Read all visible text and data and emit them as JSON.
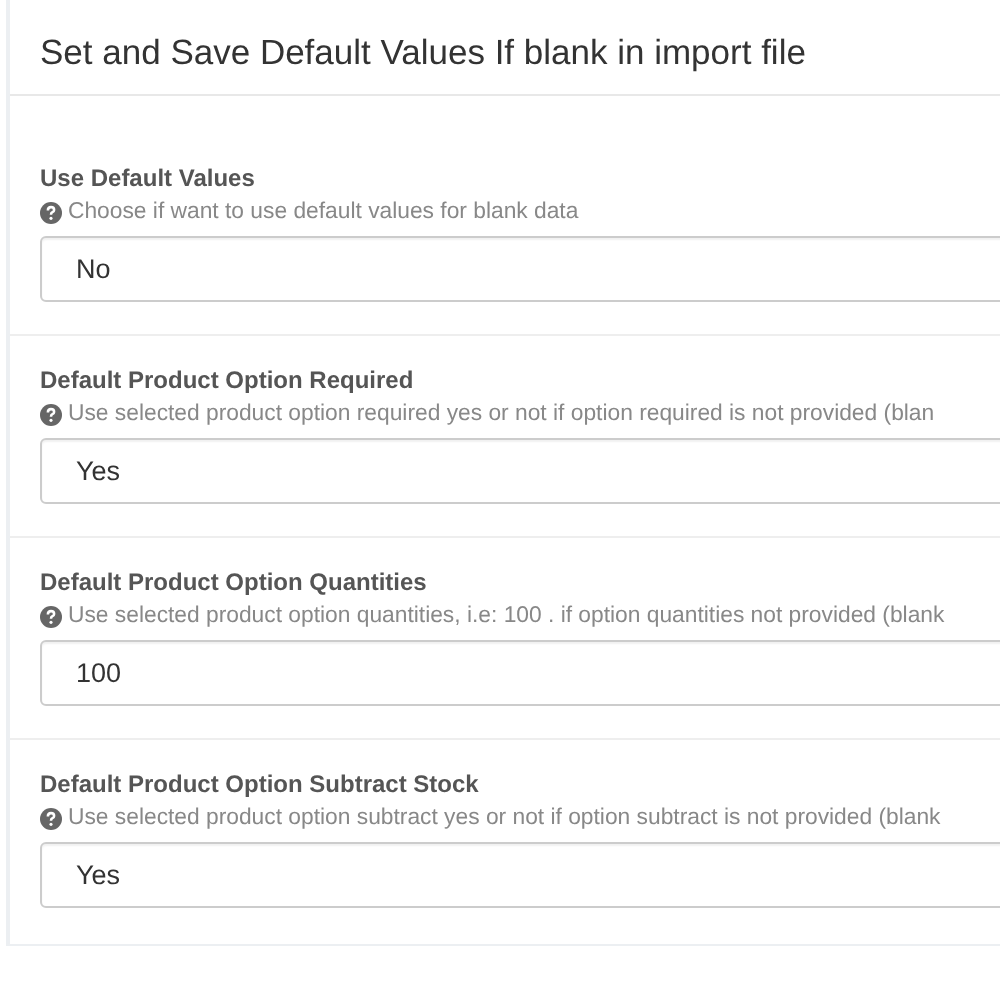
{
  "panel": {
    "title": "Set and Save Default Values If blank in import file"
  },
  "fields": [
    {
      "label": "Use Default Values",
      "help": "Choose if want to use default values for blank data",
      "value": "No"
    },
    {
      "label": "Default Product Option Required",
      "help": "Use selected product option required yes or not if option required is not provided (blan",
      "value": "Yes"
    },
    {
      "label": "Default Product Option Quantities",
      "help": "Use selected product option quantities, i.e: 100 . if option quantities not provided (blank",
      "value": "100"
    },
    {
      "label": "Default Product Option Subtract Stock",
      "help": "Use selected product option subtract yes or not if option subtract is not provided (blank",
      "value": "Yes"
    }
  ]
}
